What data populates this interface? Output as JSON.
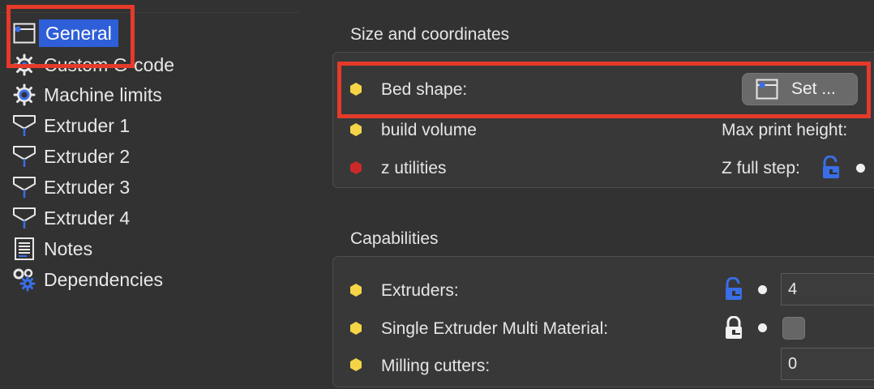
{
  "sidebar": {
    "items": [
      {
        "label": "General",
        "icon": "general-page-icon",
        "selected": true
      },
      {
        "label": "Custom G-code",
        "icon": "gear-icon"
      },
      {
        "label": "Machine limits",
        "icon": "gear-limit-icon"
      },
      {
        "label": "Extruder 1",
        "icon": "extruder-icon"
      },
      {
        "label": "Extruder 2",
        "icon": "extruder-icon"
      },
      {
        "label": "Extruder 3",
        "icon": "extruder-icon"
      },
      {
        "label": "Extruder 4",
        "icon": "extruder-icon"
      },
      {
        "label": "Notes",
        "icon": "notes-icon"
      },
      {
        "label": "Dependencies",
        "icon": "dependencies-icon"
      }
    ]
  },
  "size_section": {
    "title": "Size and coordinates",
    "bed_shape": {
      "label": "Bed shape:",
      "button_label": "Set ..."
    },
    "build_volume": {
      "label": "build volume",
      "right_label": "Max print height:"
    },
    "z_utilities": {
      "label": "z utilities",
      "right_label": "Z full step:"
    }
  },
  "capabilities_section": {
    "title": "Capabilities",
    "extruders": {
      "label": "Extruders:",
      "value": "4"
    },
    "single_extruder_mm": {
      "label": "Single Extruder Multi Material:",
      "checked": false
    },
    "milling_cutters": {
      "label": "Milling cutters:",
      "value": "0"
    }
  },
  "colors": {
    "accent": "#2f5fd8",
    "highlight": "#e53a2a",
    "bullet_simple": "#f5d547",
    "bullet_expert": "#cc2a2a",
    "lock_blue": "#3a6ee8"
  }
}
